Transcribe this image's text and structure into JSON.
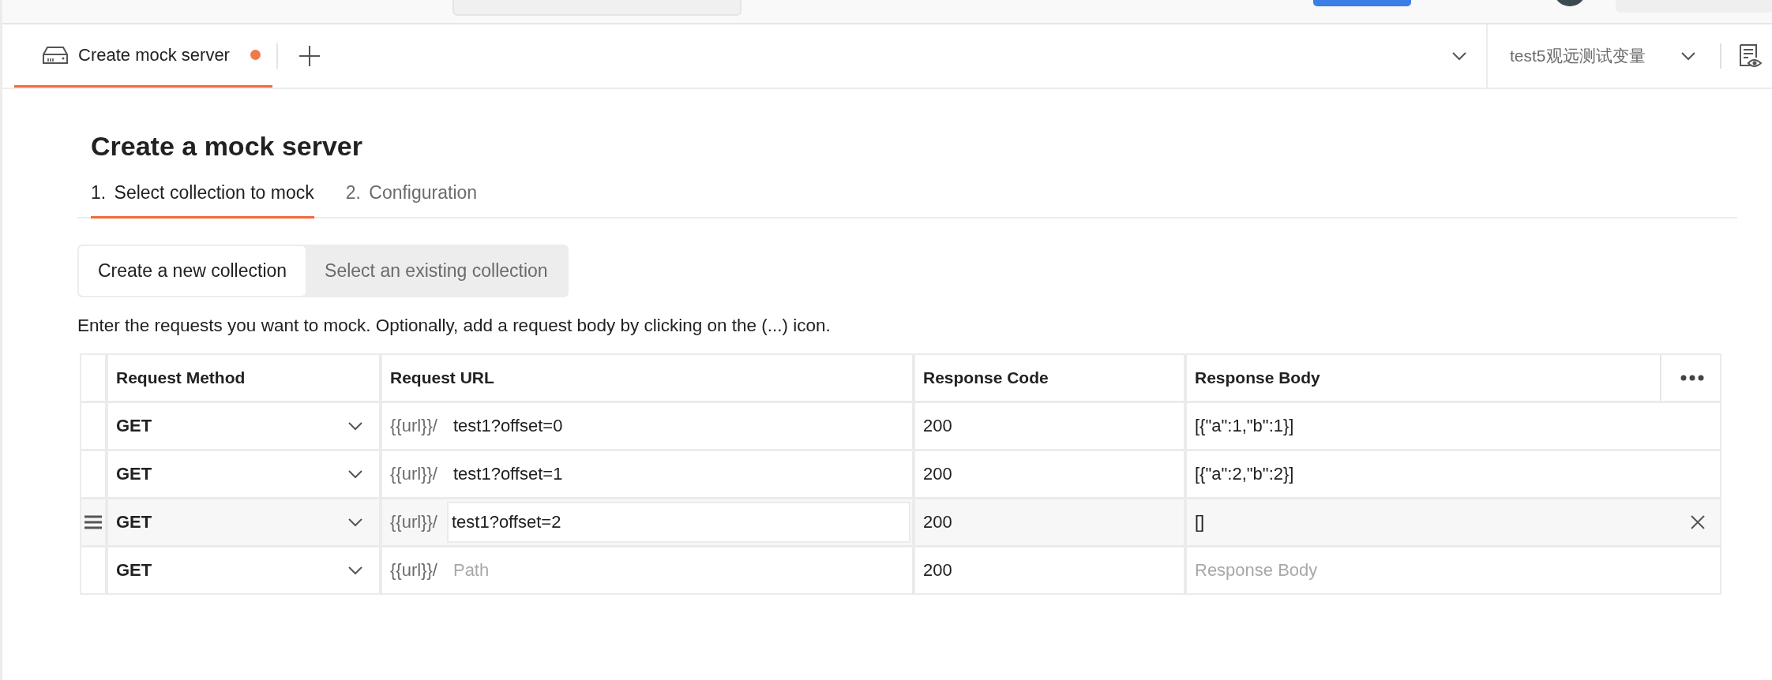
{
  "tabs": [
    {
      "label": "Create mock server",
      "unsaved": true,
      "selected": true
    }
  ],
  "environment": {
    "value": "test5观远测试变量"
  },
  "page": {
    "title": "Create a mock server",
    "steps": [
      {
        "number": "1.",
        "label": "Select collection to mock",
        "selected": true
      },
      {
        "number": "2.",
        "label": "Configuration",
        "selected": false
      }
    ],
    "collection_options": [
      {
        "label": "Create a new collection",
        "selected": true
      },
      {
        "label": "Select an existing collection",
        "selected": false
      }
    ],
    "description": "Enter the requests you want to mock. Optionally, add a request body by clicking on the (...) icon."
  },
  "table": {
    "columns": [
      "Request Method",
      "Request URL",
      "Response Code",
      "Response Body"
    ],
    "rows": [
      {
        "method": "GET",
        "url_prefix": "{{url}}/",
        "path": "test1?offset=0",
        "code": "200",
        "body": "[{\"a\":1,\"b\":1}]",
        "hovered": false,
        "focused": false
      },
      {
        "method": "GET",
        "url_prefix": "{{url}}/",
        "path": "test1?offset=1",
        "code": "200",
        "body": "[{\"a\":2,\"b\":2}]",
        "hovered": false,
        "focused": false
      },
      {
        "method": "GET",
        "url_prefix": "{{url}}/",
        "path": "test1?offset=2",
        "code": "200",
        "body": "[]",
        "hovered": true,
        "focused": true
      },
      {
        "method": "GET",
        "url_prefix": "{{url}}/",
        "path_placeholder": "Path",
        "code": "200",
        "body_placeholder": "Response Body",
        "hovered": false,
        "focused": false
      }
    ]
  }
}
